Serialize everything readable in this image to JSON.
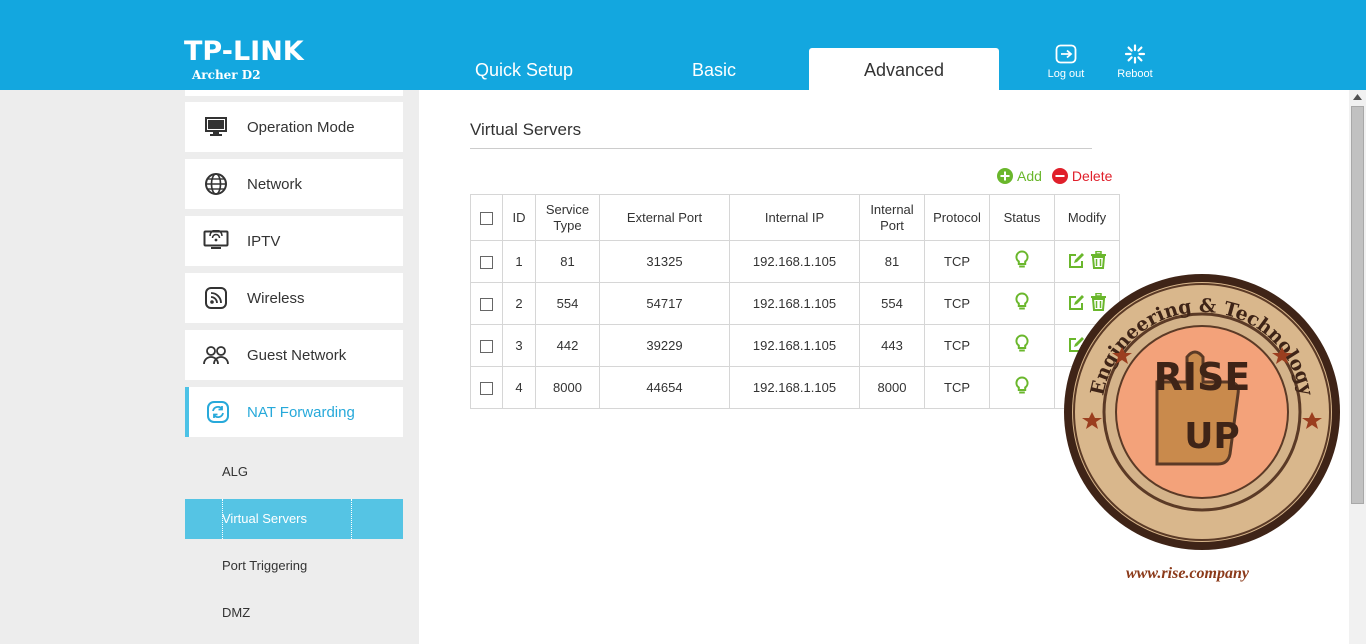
{
  "header": {
    "brand": "TP-LINK",
    "model": "Archer D2",
    "tabs": [
      {
        "label": "Quick Setup",
        "active": false
      },
      {
        "label": "Basic",
        "active": false
      },
      {
        "label": "Advanced",
        "active": true
      }
    ],
    "logout_label": "Log out",
    "reboot_label": "Reboot",
    "color_bar": "#13a7df"
  },
  "sidebar": {
    "items": [
      {
        "label": "Operation Mode",
        "icon": "monitor-icon"
      },
      {
        "label": "Network",
        "icon": "globe-icon"
      },
      {
        "label": "IPTV",
        "icon": "tv-icon"
      },
      {
        "label": "Wireless",
        "icon": "wireless-icon"
      },
      {
        "label": "Guest Network",
        "icon": "guest-network-icon"
      },
      {
        "label": "NAT Forwarding",
        "icon": "nat-forwarding-icon",
        "active": true
      }
    ],
    "subitems": [
      {
        "label": "ALG"
      },
      {
        "label": "Virtual Servers",
        "active": true
      },
      {
        "label": "Port Triggering"
      },
      {
        "label": "DMZ"
      }
    ]
  },
  "main": {
    "title": "Virtual Servers",
    "add_label": "Add",
    "delete_label": "Delete",
    "table": {
      "headers": [
        "ID",
        "Service Type",
        "External Port",
        "Internal IP",
        "Internal Port",
        "Protocol",
        "Status",
        "Modify"
      ],
      "rows": [
        {
          "id": "1",
          "service_type": "81",
          "external_port": "31325",
          "internal_ip": "192.168.1.105",
          "internal_port": "81",
          "protocol": "TCP"
        },
        {
          "id": "2",
          "service_type": "554",
          "external_port": "54717",
          "internal_ip": "192.168.1.105",
          "internal_port": "554",
          "protocol": "TCP"
        },
        {
          "id": "3",
          "service_type": "442",
          "external_port": "39229",
          "internal_ip": "192.168.1.105",
          "internal_port": "443",
          "protocol": "TCP"
        },
        {
          "id": "4",
          "service_type": "8000",
          "external_port": "44654",
          "internal_ip": "192.168.1.105",
          "internal_port": "8000",
          "protocol": "TCP"
        }
      ]
    }
  },
  "watermark": {
    "url": "www.rise.company",
    "text_top": "Engineering & Technology",
    "text_center_1": "RISE",
    "text_center_2": "UP"
  }
}
